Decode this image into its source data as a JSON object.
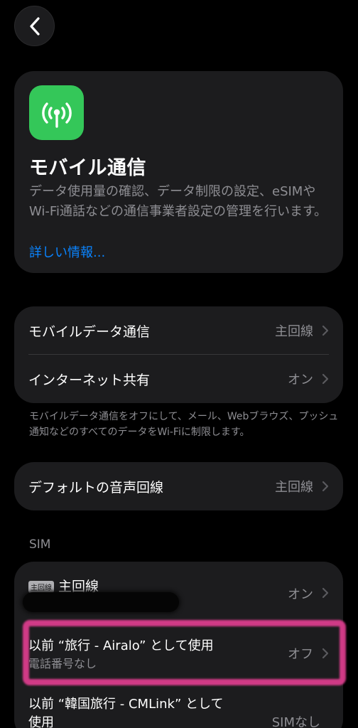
{
  "nav": {
    "back_icon": "chevron-left-icon"
  },
  "hero": {
    "icon": "antenna-icon",
    "icon_color": "#34c759",
    "title": "モバイル通信",
    "description": "データ使用量の確認、データ制限の設定、eSIMやWi-Fi通話などの通信事業者設定の管理を行います。",
    "link": "詳しい情報..."
  },
  "mobile_group": {
    "rows": [
      {
        "label": "モバイルデータ通信",
        "value": "主回線"
      },
      {
        "label": "インターネット共有",
        "value": "オン"
      }
    ],
    "footnote": "モバイルデータ通信をオフにして、メール、Webブラウズ、プッシュ通知などのすべてのデータをWi-Fiに制限します。"
  },
  "voice_group": {
    "rows": [
      {
        "label": "デフォルトの音声回線",
        "value": "主回線"
      }
    ]
  },
  "sim_section": {
    "header": "SIM",
    "rows": [
      {
        "badge": "主回線",
        "label": "主回線",
        "value": "オン"
      },
      {
        "label": "以前 “旅行 - Airalo” として使用",
        "sublabel": "電話番号なし",
        "value": "オフ"
      },
      {
        "label": "以前 “韓国旅行 - CMLink” として",
        "label2": "使用",
        "value": "SIMなし"
      }
    ]
  },
  "colors": {
    "accent": "#0a84ff",
    "highlight": "#e03d8f",
    "background": "#000000",
    "card": "#1c1c1e"
  }
}
